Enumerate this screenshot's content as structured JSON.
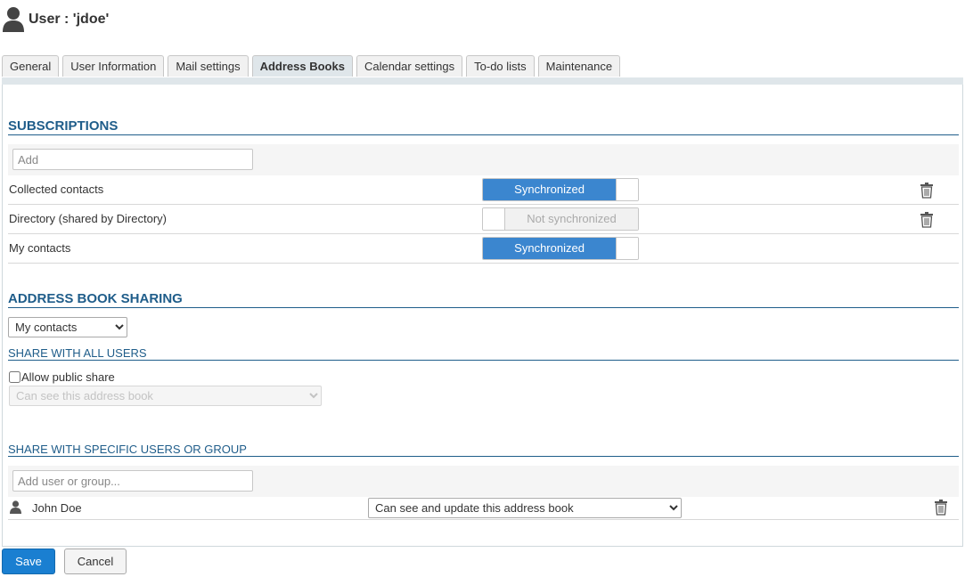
{
  "header": {
    "title": "User : 'jdoe'"
  },
  "tabs": [
    {
      "label": "General",
      "active": false
    },
    {
      "label": "User Information",
      "active": false
    },
    {
      "label": "Mail settings",
      "active": false
    },
    {
      "label": "Address Books",
      "active": true
    },
    {
      "label": "Calendar settings",
      "active": false
    },
    {
      "label": "To-do lists",
      "active": false
    },
    {
      "label": "Maintenance",
      "active": false
    }
  ],
  "subscriptions": {
    "title": "SUBSCRIPTIONS",
    "add_placeholder": "Add",
    "rows": [
      {
        "label": "Collected contacts",
        "status": "Synchronized",
        "synced": true
      },
      {
        "label": "Directory (shared by Directory)",
        "status": "Not synchronized",
        "synced": false
      },
      {
        "label": "My contacts",
        "status": "Synchronized",
        "synced": true
      }
    ]
  },
  "sharing": {
    "title": "ADDRESS BOOK SHARING",
    "selected_book": "My contacts",
    "all_users": {
      "title": "SHARE WITH ALL USERS",
      "checkbox_label": "Allow public share",
      "checked": false,
      "permission": "Can see this address book"
    },
    "specific": {
      "title": "SHARE WITH SPECIFIC USERS OR GROUP",
      "add_placeholder": "Add user or group...",
      "entries": [
        {
          "name": "John Doe",
          "permission": "Can see and update this address book"
        }
      ]
    }
  },
  "footer": {
    "save_label": "Save",
    "cancel_label": "Cancel"
  },
  "colors": {
    "accent": "#1f5d8a",
    "toggle_on": "#3b86cf",
    "primary_button": "#1a7fd1"
  }
}
